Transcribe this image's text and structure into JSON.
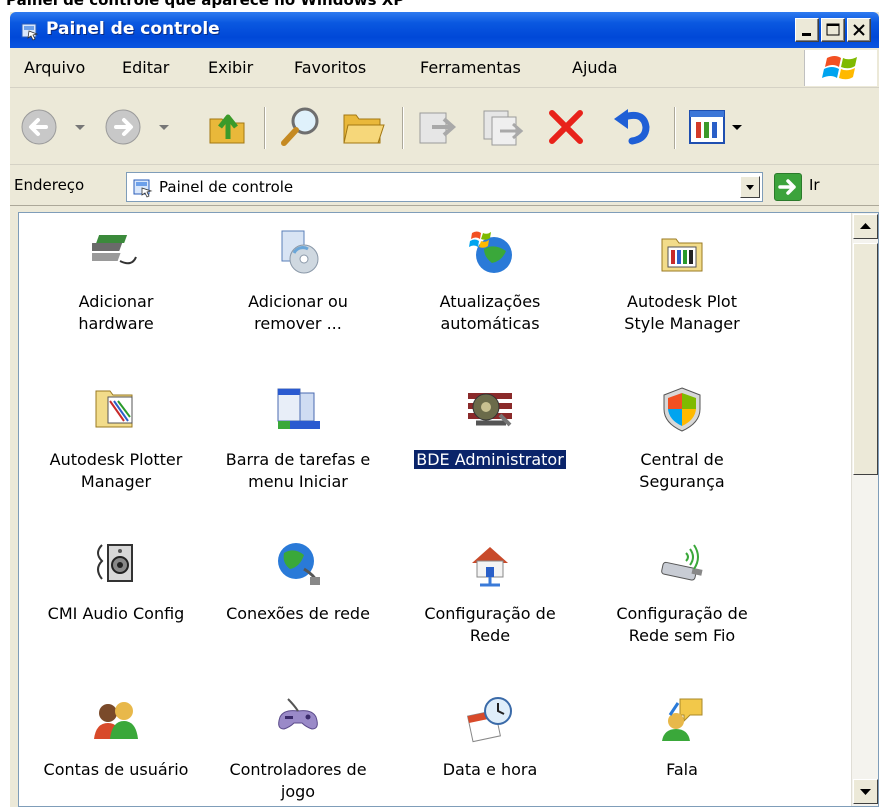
{
  "clipped_heading": "Painel de controle que aparece no Windows XP",
  "window": {
    "title": "Painel de controle",
    "caption_buttons": [
      "minimize-icon",
      "maximize-icon",
      "close-icon"
    ]
  },
  "menu": [
    "Arquivo",
    "Editar",
    "Exibir",
    "Favoritos",
    "Ferramentas",
    "Ajuda"
  ],
  "toolbar": {
    "icons": [
      "back-icon",
      "forward-icon",
      "up-folder-icon",
      "search-icon",
      "folders-icon",
      "move-to-icon",
      "copy-to-icon",
      "delete-icon",
      "undo-icon",
      "views-icon"
    ]
  },
  "address": {
    "label": "Endereço",
    "value": "Painel de controle",
    "go_label": "Ir"
  },
  "items": [
    {
      "lines": [
        "Adicionar",
        "hardware"
      ],
      "icon": "add-hardware-icon"
    },
    {
      "lines": [
        "Adicionar ou",
        "remover ..."
      ],
      "icon": "add-remove-programs-icon"
    },
    {
      "lines": [
        "Atualizações",
        "automáticas"
      ],
      "icon": "windows-update-icon"
    },
    {
      "lines": [
        "Autodesk Plot",
        "Style Manager"
      ],
      "icon": "plot-style-folder-icon"
    },
    {
      "lines": [
        "Autodesk Plotter",
        "Manager"
      ],
      "icon": "plotter-folder-icon"
    },
    {
      "lines": [
        "Barra de tarefas e",
        "menu Iniciar"
      ],
      "icon": "taskbar-icon"
    },
    {
      "lines": [
        "BDE Administrator",
        ""
      ],
      "icon": "bde-administrator-icon",
      "selected": true
    },
    {
      "lines": [
        "Central de",
        "Segurança"
      ],
      "icon": "security-shield-icon"
    },
    {
      "lines": [
        "CMI Audio Config",
        ""
      ],
      "icon": "speaker-icon"
    },
    {
      "lines": [
        "Conexões de rede",
        ""
      ],
      "icon": "network-globe-icon"
    },
    {
      "lines": [
        "Configuração de",
        "Rede"
      ],
      "icon": "home-network-icon"
    },
    {
      "lines": [
        "Configuração de",
        "Rede sem Fio"
      ],
      "icon": "wireless-network-icon"
    },
    {
      "lines": [
        "Contas de usuário",
        ""
      ],
      "icon": "user-accounts-icon"
    },
    {
      "lines": [
        "Controladores de",
        "jogo"
      ],
      "icon": "game-controller-icon"
    },
    {
      "lines": [
        "Data e hora",
        ""
      ],
      "icon": "date-time-icon"
    },
    {
      "lines": [
        "Fala",
        ""
      ],
      "icon": "speech-icon"
    }
  ],
  "colors": {
    "title_bar": "#0048d8",
    "selection": "#0a246a",
    "window_face": "#ece9d8"
  }
}
